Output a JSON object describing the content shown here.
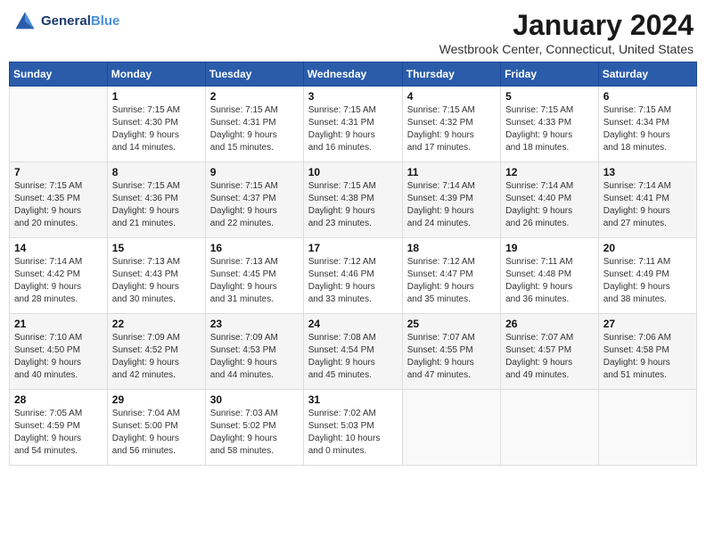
{
  "header": {
    "logo_line1": "General",
    "logo_line2": "Blue",
    "month": "January 2024",
    "location": "Westbrook Center, Connecticut, United States"
  },
  "weekdays": [
    "Sunday",
    "Monday",
    "Tuesday",
    "Wednesday",
    "Thursday",
    "Friday",
    "Saturday"
  ],
  "weeks": [
    [
      {
        "day": "",
        "info": ""
      },
      {
        "day": "1",
        "info": "Sunrise: 7:15 AM\nSunset: 4:30 PM\nDaylight: 9 hours\nand 14 minutes."
      },
      {
        "day": "2",
        "info": "Sunrise: 7:15 AM\nSunset: 4:31 PM\nDaylight: 9 hours\nand 15 minutes."
      },
      {
        "day": "3",
        "info": "Sunrise: 7:15 AM\nSunset: 4:31 PM\nDaylight: 9 hours\nand 16 minutes."
      },
      {
        "day": "4",
        "info": "Sunrise: 7:15 AM\nSunset: 4:32 PM\nDaylight: 9 hours\nand 17 minutes."
      },
      {
        "day": "5",
        "info": "Sunrise: 7:15 AM\nSunset: 4:33 PM\nDaylight: 9 hours\nand 18 minutes."
      },
      {
        "day": "6",
        "info": "Sunrise: 7:15 AM\nSunset: 4:34 PM\nDaylight: 9 hours\nand 18 minutes."
      }
    ],
    [
      {
        "day": "7",
        "info": "Sunrise: 7:15 AM\nSunset: 4:35 PM\nDaylight: 9 hours\nand 20 minutes."
      },
      {
        "day": "8",
        "info": "Sunrise: 7:15 AM\nSunset: 4:36 PM\nDaylight: 9 hours\nand 21 minutes."
      },
      {
        "day": "9",
        "info": "Sunrise: 7:15 AM\nSunset: 4:37 PM\nDaylight: 9 hours\nand 22 minutes."
      },
      {
        "day": "10",
        "info": "Sunrise: 7:15 AM\nSunset: 4:38 PM\nDaylight: 9 hours\nand 23 minutes."
      },
      {
        "day": "11",
        "info": "Sunrise: 7:14 AM\nSunset: 4:39 PM\nDaylight: 9 hours\nand 24 minutes."
      },
      {
        "day": "12",
        "info": "Sunrise: 7:14 AM\nSunset: 4:40 PM\nDaylight: 9 hours\nand 26 minutes."
      },
      {
        "day": "13",
        "info": "Sunrise: 7:14 AM\nSunset: 4:41 PM\nDaylight: 9 hours\nand 27 minutes."
      }
    ],
    [
      {
        "day": "14",
        "info": "Sunrise: 7:14 AM\nSunset: 4:42 PM\nDaylight: 9 hours\nand 28 minutes."
      },
      {
        "day": "15",
        "info": "Sunrise: 7:13 AM\nSunset: 4:43 PM\nDaylight: 9 hours\nand 30 minutes."
      },
      {
        "day": "16",
        "info": "Sunrise: 7:13 AM\nSunset: 4:45 PM\nDaylight: 9 hours\nand 31 minutes."
      },
      {
        "day": "17",
        "info": "Sunrise: 7:12 AM\nSunset: 4:46 PM\nDaylight: 9 hours\nand 33 minutes."
      },
      {
        "day": "18",
        "info": "Sunrise: 7:12 AM\nSunset: 4:47 PM\nDaylight: 9 hours\nand 35 minutes."
      },
      {
        "day": "19",
        "info": "Sunrise: 7:11 AM\nSunset: 4:48 PM\nDaylight: 9 hours\nand 36 minutes."
      },
      {
        "day": "20",
        "info": "Sunrise: 7:11 AM\nSunset: 4:49 PM\nDaylight: 9 hours\nand 38 minutes."
      }
    ],
    [
      {
        "day": "21",
        "info": "Sunrise: 7:10 AM\nSunset: 4:50 PM\nDaylight: 9 hours\nand 40 minutes."
      },
      {
        "day": "22",
        "info": "Sunrise: 7:09 AM\nSunset: 4:52 PM\nDaylight: 9 hours\nand 42 minutes."
      },
      {
        "day": "23",
        "info": "Sunrise: 7:09 AM\nSunset: 4:53 PM\nDaylight: 9 hours\nand 44 minutes."
      },
      {
        "day": "24",
        "info": "Sunrise: 7:08 AM\nSunset: 4:54 PM\nDaylight: 9 hours\nand 45 minutes."
      },
      {
        "day": "25",
        "info": "Sunrise: 7:07 AM\nSunset: 4:55 PM\nDaylight: 9 hours\nand 47 minutes."
      },
      {
        "day": "26",
        "info": "Sunrise: 7:07 AM\nSunset: 4:57 PM\nDaylight: 9 hours\nand 49 minutes."
      },
      {
        "day": "27",
        "info": "Sunrise: 7:06 AM\nSunset: 4:58 PM\nDaylight: 9 hours\nand 51 minutes."
      }
    ],
    [
      {
        "day": "28",
        "info": "Sunrise: 7:05 AM\nSunset: 4:59 PM\nDaylight: 9 hours\nand 54 minutes."
      },
      {
        "day": "29",
        "info": "Sunrise: 7:04 AM\nSunset: 5:00 PM\nDaylight: 9 hours\nand 56 minutes."
      },
      {
        "day": "30",
        "info": "Sunrise: 7:03 AM\nSunset: 5:02 PM\nDaylight: 9 hours\nand 58 minutes."
      },
      {
        "day": "31",
        "info": "Sunrise: 7:02 AM\nSunset: 5:03 PM\nDaylight: 10 hours\nand 0 minutes."
      },
      {
        "day": "",
        "info": ""
      },
      {
        "day": "",
        "info": ""
      },
      {
        "day": "",
        "info": ""
      }
    ]
  ]
}
